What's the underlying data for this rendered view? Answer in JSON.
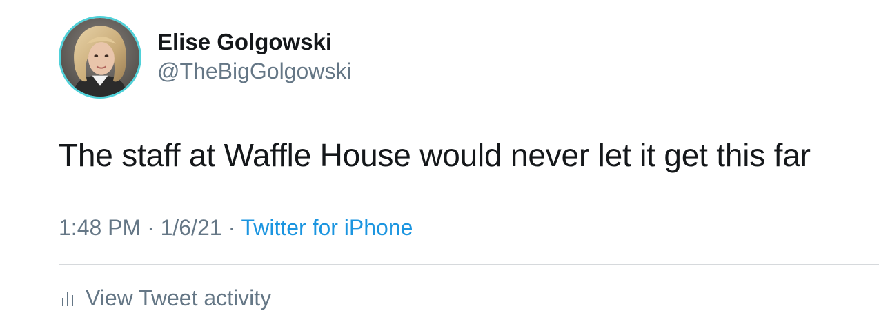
{
  "tweet": {
    "author": {
      "display_name": "Elise Golgowski",
      "handle": "@TheBigGolgowski"
    },
    "text": "The staff at Waffle House would never let it get this far",
    "meta": {
      "time": "1:48 PM",
      "separator": "·",
      "date": "1/6/21",
      "source": "Twitter for iPhone"
    },
    "activity_label": "View Tweet activity"
  },
  "icons": {
    "activity": "bar-chart-icon",
    "avatar": "profile-photo"
  },
  "colors": {
    "primary_text": "#14171a",
    "secondary_text": "#657786",
    "link": "#1b95e0",
    "avatar_ring": "#4fd1d9",
    "divider": "#d6d9dc"
  }
}
